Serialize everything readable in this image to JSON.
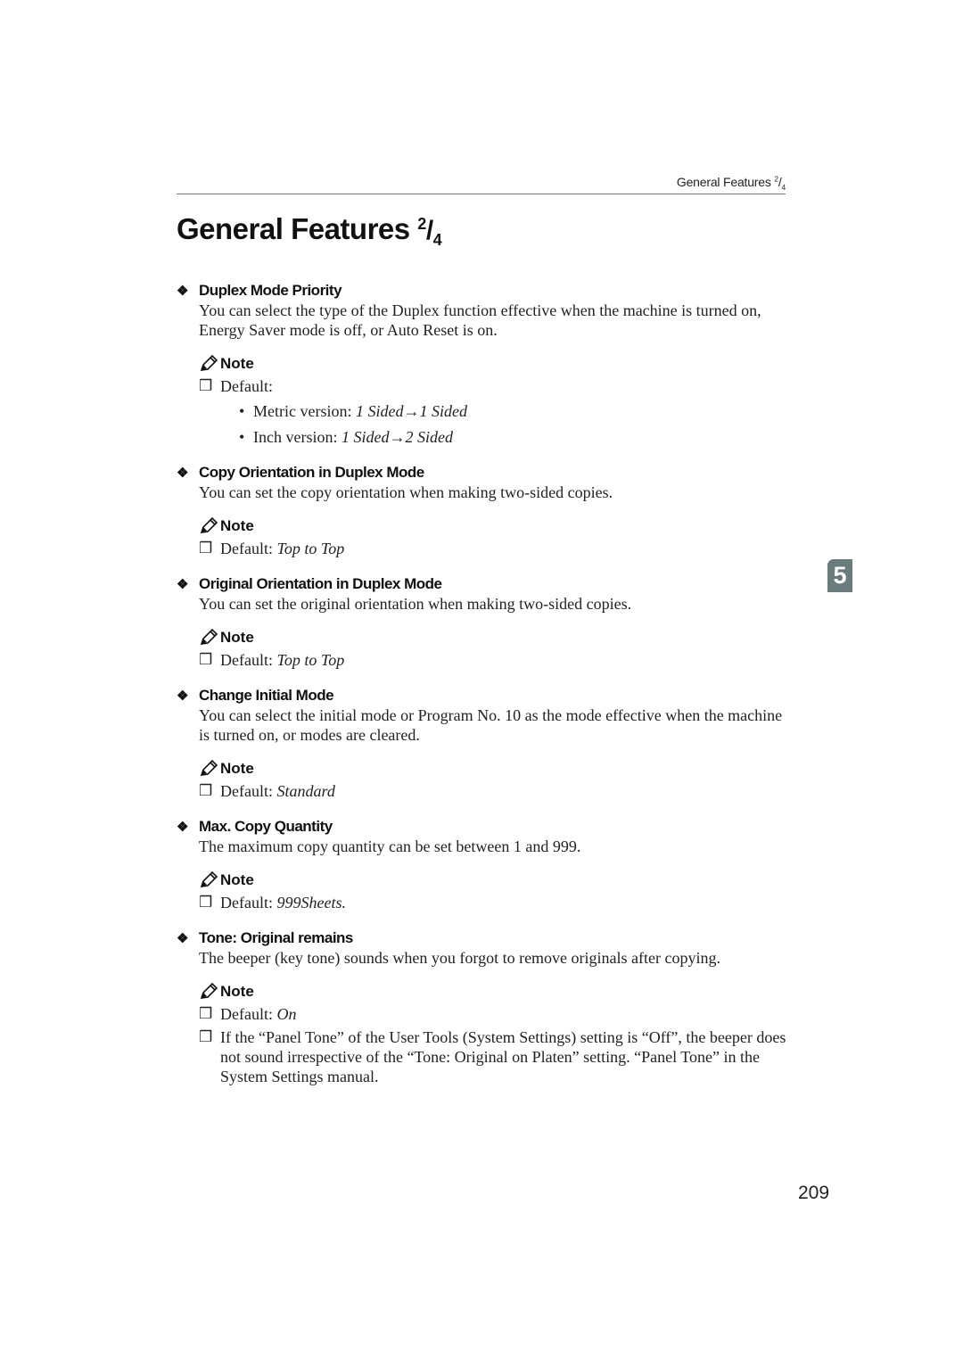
{
  "running_header": {
    "text": "General Features",
    "num": "2",
    "den": "4"
  },
  "title": {
    "text": "General Features",
    "num": "2",
    "den": "4"
  },
  "note_label": "Note",
  "chapter_tab": "5",
  "page_number": "209",
  "sections": [
    {
      "heading": "Duplex Mode Priority",
      "body": "You can select the type of the Duplex function effective when the machine is turned on, Energy Saver mode is off, or Auto Reset is on.",
      "notes": [
        {
          "prefix": "Default:",
          "value": ""
        }
      ],
      "bullets": [
        {
          "label": "Metric version: ",
          "value": "1 Sided→1 Sided"
        },
        {
          "label": "Inch version: ",
          "value": "1 Sided→2 Sided"
        }
      ]
    },
    {
      "heading": "Copy Orientation in Duplex Mode",
      "body": "You can set the copy orientation when making two-sided copies.",
      "notes": [
        {
          "prefix": "Default: ",
          "value": "Top to Top"
        }
      ]
    },
    {
      "heading": "Original Orientation in Duplex Mode",
      "body": "You can set the original orientation when making two-sided copies.",
      "notes": [
        {
          "prefix": "Default: ",
          "value": "Top to Top"
        }
      ]
    },
    {
      "heading": "Change Initial Mode",
      "body": "You can select the initial mode or Program No. 10 as the mode effective when the machine is turned on, or modes are cleared.",
      "notes": [
        {
          "prefix": "Default: ",
          "value": "Standard"
        }
      ]
    },
    {
      "heading": "Max. Copy Quantity",
      "body": "The maximum copy quantity can be set between 1 and 999.",
      "notes": [
        {
          "prefix": "Default: ",
          "value": "999Sheets."
        }
      ]
    },
    {
      "heading": "Tone: Original remains",
      "body": "The beeper (key tone) sounds when you forgot to remove originals after copying.",
      "notes": [
        {
          "prefix": "Default: ",
          "value": "On"
        },
        {
          "prefix": "If the “Panel Tone” of the User Tools (System Settings) setting is “Off”, the beeper does not sound irrespective of the “Tone: Original on Platen” setting. “Panel Tone” in the System Settings manual.",
          "value": ""
        }
      ]
    }
  ]
}
